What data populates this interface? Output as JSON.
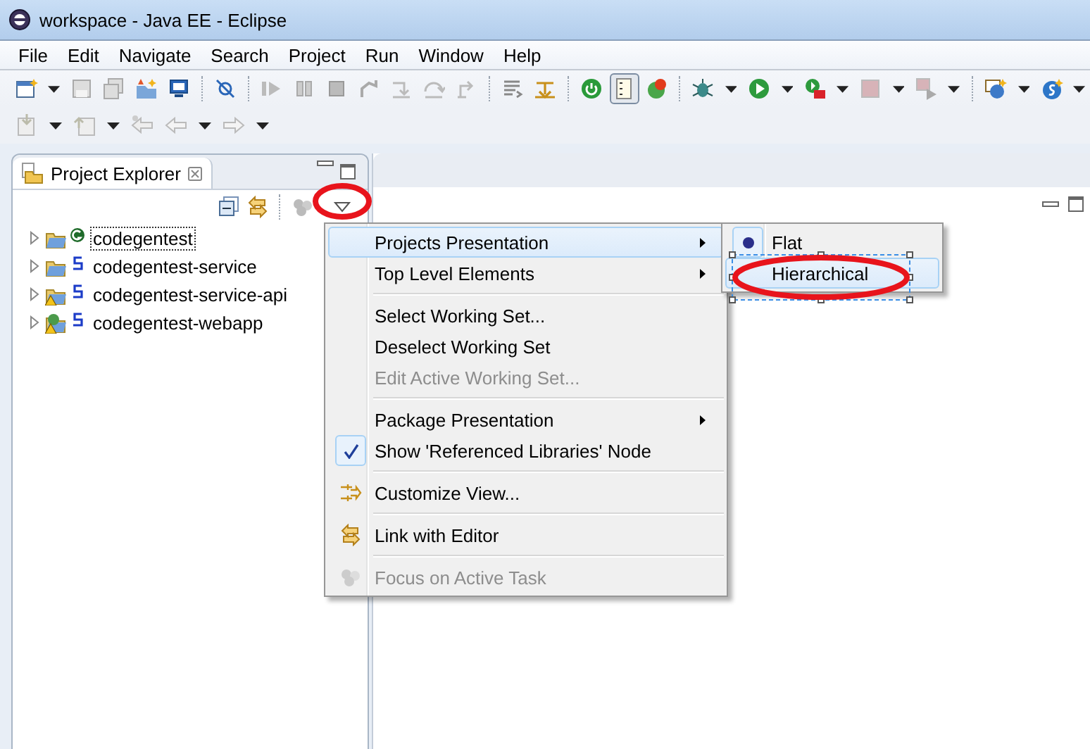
{
  "window": {
    "title": "workspace - Java EE - Eclipse"
  },
  "menu_bar": [
    "File",
    "Edit",
    "Navigate",
    "Search",
    "Project",
    "Run",
    "Window",
    "Help"
  ],
  "project_explorer": {
    "title": "Project Explorer",
    "projects": [
      {
        "name": "codegentest",
        "selected": true,
        "kind": "plain"
      },
      {
        "name": "codegentest-service",
        "selected": false,
        "kind": "plain"
      },
      {
        "name": "codegentest-service-api",
        "selected": false,
        "kind": "warning"
      },
      {
        "name": "codegentest-webapp",
        "selected": false,
        "kind": "web"
      }
    ]
  },
  "view_menu": {
    "items": [
      {
        "kind": "item",
        "label": "Projects Presentation",
        "submenu": true,
        "highlighted": true,
        "disabled": false
      },
      {
        "kind": "item",
        "label": "Top Level Elements",
        "submenu": true,
        "highlighted": false,
        "disabled": false
      },
      {
        "kind": "separator"
      },
      {
        "kind": "item",
        "label": "Select Working Set...",
        "submenu": false,
        "highlighted": false,
        "disabled": false
      },
      {
        "kind": "item",
        "label": "Deselect Working Set",
        "submenu": false,
        "highlighted": false,
        "disabled": false
      },
      {
        "kind": "item",
        "label": "Edit Active Working Set...",
        "submenu": false,
        "highlighted": false,
        "disabled": true
      },
      {
        "kind": "separator"
      },
      {
        "kind": "item",
        "label": "Package Presentation",
        "submenu": true,
        "highlighted": false,
        "disabled": false
      },
      {
        "kind": "toggle",
        "label": "Show 'Referenced Libraries' Node",
        "checked": true,
        "highlighted": false,
        "disabled": false
      },
      {
        "kind": "separator"
      },
      {
        "kind": "customize",
        "label": "Customize View...",
        "highlighted": false,
        "disabled": false
      },
      {
        "kind": "separator"
      },
      {
        "kind": "link",
        "label": "Link with Editor",
        "highlighted": false,
        "disabled": false
      },
      {
        "kind": "separator"
      },
      {
        "kind": "focus",
        "label": "Focus on Active Task",
        "highlighted": false,
        "disabled": true
      }
    ]
  },
  "presentation_submenu": {
    "items": [
      {
        "label": "Flat",
        "selected": true,
        "highlighted": false
      },
      {
        "label": "Hierarchical",
        "selected": false,
        "highlighted": true
      }
    ]
  }
}
